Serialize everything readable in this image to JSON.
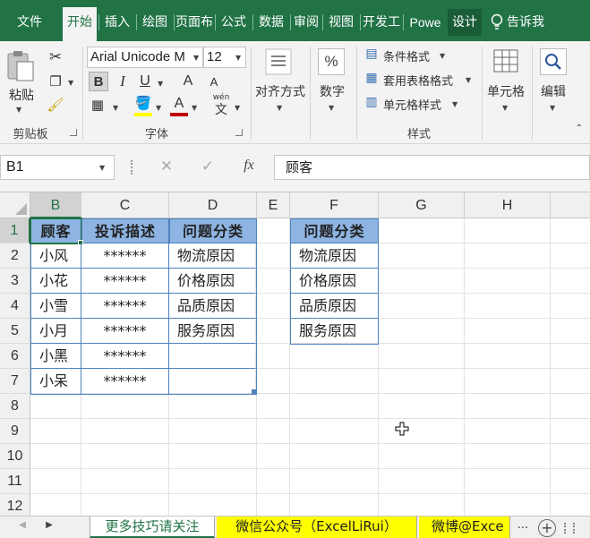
{
  "ribbon_tabs": [
    "文件",
    "开始",
    "插入",
    "绘图",
    "页面布",
    "公式",
    "数据",
    "审阅",
    "视图",
    "开发工",
    "Powe",
    "设计"
  ],
  "tell_me": "告诉我",
  "clipboard": {
    "paste_label": "粘贴",
    "group_label": "剪贴板"
  },
  "font": {
    "name": "Arial Unicode M",
    "size": "12",
    "bold": "B",
    "italic": "I",
    "underline": "U",
    "grow": "A",
    "shrink": "A",
    "color_letter": "A",
    "phonetic": "wén",
    "phonetic_char": "文",
    "group_label": "字体"
  },
  "alignment_label": "对齐方式",
  "number_label": "数字",
  "styles": {
    "conditional": "条件格式",
    "table_format": "套用表格格式",
    "cell_styles": "单元格样式",
    "group_label": "样式"
  },
  "cells_label": "单元格",
  "editing_label": "编辑",
  "formula_bar": {
    "name_box": "B1",
    "fx": "fx",
    "content": "顾客"
  },
  "columns": [
    "B",
    "C",
    "D",
    "E",
    "F",
    "G",
    "H"
  ],
  "rows": [
    "1",
    "2",
    "3",
    "4",
    "5",
    "6",
    "7",
    "8",
    "9",
    "10",
    "11",
    "12"
  ],
  "table": {
    "headers": [
      "顾客",
      "投诉描述",
      "问题分类"
    ],
    "rows": [
      [
        "小风",
        "******",
        "物流原因"
      ],
      [
        "小花",
        "******",
        "价格原因"
      ],
      [
        "小雪",
        "******",
        "品质原因"
      ],
      [
        "小月",
        "******",
        "服务原因"
      ],
      [
        "小黑",
        "******",
        ""
      ],
      [
        "小呆",
        "******",
        ""
      ]
    ]
  },
  "category_list": {
    "header": "问题分类",
    "items": [
      "物流原因",
      "价格原因",
      "品质原因",
      "服务原因"
    ]
  },
  "sheet_tabs": [
    "更多技巧请关注",
    "微信公众号（ExcelLiRui）",
    "微博@Exce"
  ],
  "sheet_more": "...",
  "colors": {
    "excel_green": "#217346",
    "table_header": "#8db4e2",
    "table_border": "#4f81bd",
    "tab_yellow": "#ffff00"
  }
}
